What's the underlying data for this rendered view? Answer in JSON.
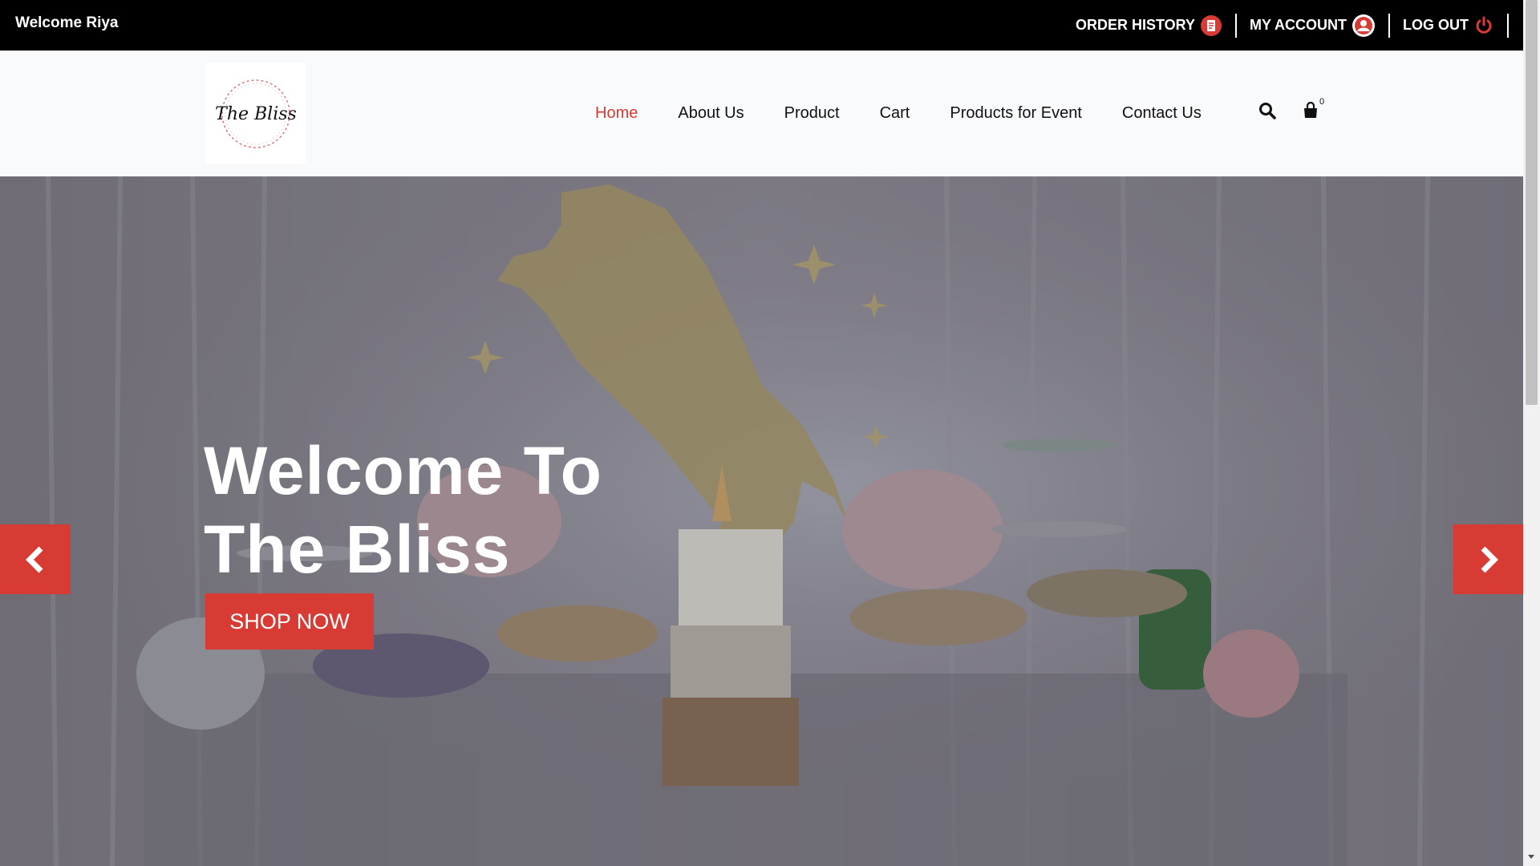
{
  "topbar": {
    "welcome": "Welcome Riya",
    "order_history": "ORDER HISTORY",
    "my_account": "MY ACCOUNT",
    "log_out": "LOG OUT"
  },
  "logo": {
    "text": "The Bliss"
  },
  "nav": {
    "items": [
      {
        "label": "Home",
        "active": true
      },
      {
        "label": "About Us"
      },
      {
        "label": "Product"
      },
      {
        "label": "Cart"
      },
      {
        "label": "Products for Event"
      },
      {
        "label": "Contact Us"
      }
    ]
  },
  "header_icons": {
    "search": "search-icon",
    "cart": "shopping-bag-icon",
    "cart_count": "0"
  },
  "hero": {
    "title_line1": "Welcome To",
    "title_line2": "The Bliss",
    "button": "SHOP NOW",
    "prev": "chevron-left-icon",
    "next": "chevron-right-icon"
  },
  "colors": {
    "accent": "#d83a34",
    "topbar": "#000000",
    "header": "#f9fafb"
  }
}
